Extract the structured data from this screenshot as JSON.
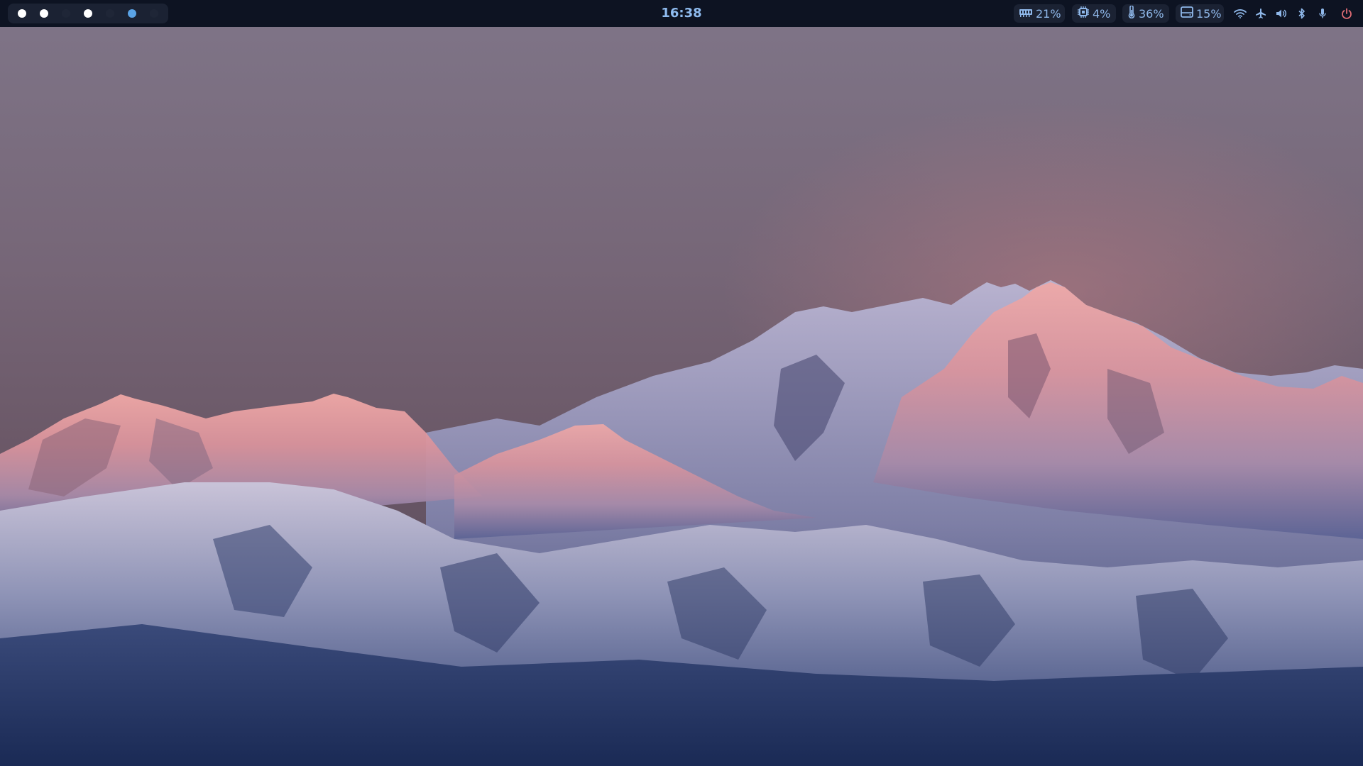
{
  "topbar": {
    "clock": "16:38",
    "workspaces": [
      {
        "id": 1,
        "state": "occupied"
      },
      {
        "id": 2,
        "state": "occupied"
      },
      {
        "id": 3,
        "state": "empty"
      },
      {
        "id": 4,
        "state": "occupied"
      },
      {
        "id": 5,
        "state": "empty"
      },
      {
        "id": 6,
        "state": "active"
      },
      {
        "id": 7,
        "state": "empty"
      }
    ],
    "stats": {
      "ram": {
        "icon": "memory-icon",
        "value": "21%"
      },
      "cpu": {
        "icon": "cpu-icon",
        "value": "4%"
      },
      "temperature": {
        "icon": "thermometer-icon",
        "value": "36%"
      },
      "disk": {
        "icon": "disk-icon",
        "value": "15%"
      }
    },
    "tray": [
      "wifi-icon",
      "airplane-icon",
      "volume-icon",
      "bluetooth-icon",
      "microphone-icon",
      "power-icon"
    ]
  },
  "colors": {
    "bar_bg": "#0d1322",
    "pill_bg": "#1b2233",
    "accent": "#8fbcf0",
    "ws_active": "#5aa3e6",
    "ws_occupied": "#ffffff",
    "ws_empty": "#1f2637",
    "power": "#e06c75"
  }
}
